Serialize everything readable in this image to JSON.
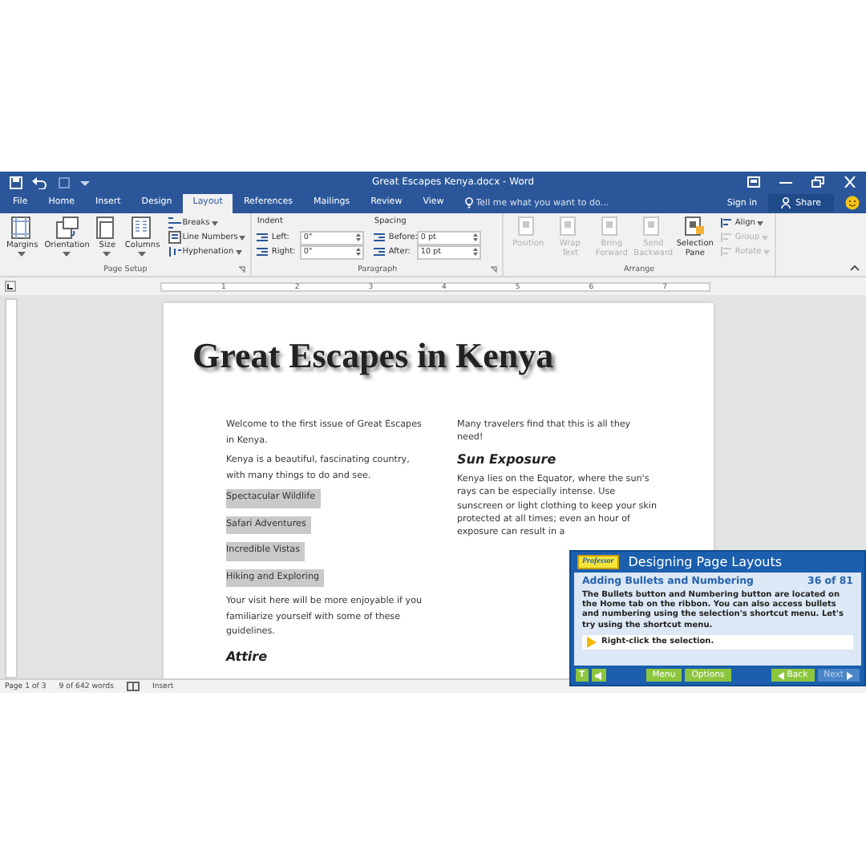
{
  "window": {
    "title": "Great Escapes Kenya.docx - Word",
    "tell_me": {
      "placeholder": "Tell me what you want to do..."
    },
    "sign_in": "Sign in",
    "share": "Share"
  },
  "tabs": [
    {
      "label": "File",
      "selected": false
    },
    {
      "label": "Home",
      "selected": false
    },
    {
      "label": "Insert",
      "selected": false
    },
    {
      "label": "Design",
      "selected": false
    },
    {
      "label": "Layout",
      "selected": true
    },
    {
      "label": "References",
      "selected": false
    },
    {
      "label": "Mailings",
      "selected": false
    },
    {
      "label": "Review",
      "selected": false
    },
    {
      "label": "View",
      "selected": false
    }
  ],
  "ribbon": {
    "page_setup": {
      "label": "Page Setup",
      "large": [
        {
          "label": "Margins",
          "kind": "margins"
        },
        {
          "label": "Orientation",
          "kind": "orientation"
        },
        {
          "label": "Size",
          "kind": "size"
        },
        {
          "label": "Columns",
          "kind": "columns"
        }
      ],
      "small": [
        "Breaks",
        "Line Numbers",
        "Hyphenation"
      ]
    },
    "paragraph": {
      "label": "Paragraph",
      "indent": "Indent",
      "left_label": "Left:",
      "left": "0\"",
      "right_label": "Right:",
      "right": "0\"",
      "spacing": "Spacing",
      "before_label": "Before:",
      "before": "0 pt",
      "after_label": "After:",
      "after": "10 pt"
    },
    "arrange": {
      "label": "Arrange",
      "large": [
        {
          "label": "Position",
          "disabled": true
        },
        {
          "label": "Wrap Text",
          "disabled": true
        },
        {
          "label": "Bring Forward",
          "disabled": true
        },
        {
          "label": "Send Backward",
          "disabled": true
        },
        {
          "label": "Selection Pane",
          "disabled": false
        }
      ],
      "small": [
        {
          "label": "Align",
          "disabled": false
        },
        {
          "label": "Group",
          "disabled": true
        },
        {
          "label": "Rotate",
          "disabled": true
        }
      ]
    }
  },
  "ruler": [
    "1",
    "2",
    "3",
    "4",
    "5",
    "6",
    "7"
  ],
  "document": {
    "title": "Great Escapes in Kenya",
    "left_column": [
      {
        "kind": "para",
        "text": "Welcome to the first issue of Great Escapes in Kenya."
      },
      {
        "kind": "para",
        "text": "Kenya is a beautiful, fascinating country, with many things to do and see."
      },
      {
        "kind": "item",
        "text": "Spectacular Wildlife",
        "selected": true
      },
      {
        "kind": "item",
        "text": "Safari Adventures",
        "selected": true
      },
      {
        "kind": "item",
        "text": "Incredible Vistas",
        "selected": true
      },
      {
        "kind": "item",
        "text": "Hiking and Exploring",
        "selected": true
      },
      {
        "kind": "para",
        "text": "Your visit here will be more enjoyable if you familiarize yourself with some of these guidelines."
      },
      {
        "kind": "heading",
        "text": "Attire"
      }
    ],
    "right_column": [
      {
        "kind": "para",
        "text": "Many travelers find that this is all they need!"
      },
      {
        "kind": "heading",
        "text": "Sun Exposure"
      },
      {
        "kind": "para",
        "text": "Kenya lies on the Equator, where the sun's rays can be especially intense. Use sunscreen or light clothing to keep your skin protected at all times; even an hour of exposure can result in a"
      }
    ]
  },
  "status_bar": {
    "page": "Page 1 of 3",
    "words": "9 of 642 words",
    "mode": "Insert"
  },
  "tutorial": {
    "logo": "Professor",
    "title": "Designing Page Layouts",
    "lesson": "Adding Bullets and Numbering",
    "counter": "36 of 81",
    "body": "The Bullets button and Numbering button are located on the Home tab on the ribbon. You can also access bullets and numbering using the selection's shortcut menu. Let's try using the shortcut menu.",
    "instruction": "Right-click the selection.",
    "text_button": "T",
    "menu": "Menu",
    "options": "Options",
    "back": {
      "label": "Back",
      "disabled": false
    },
    "next": {
      "label": "Next",
      "disabled": true
    }
  }
}
